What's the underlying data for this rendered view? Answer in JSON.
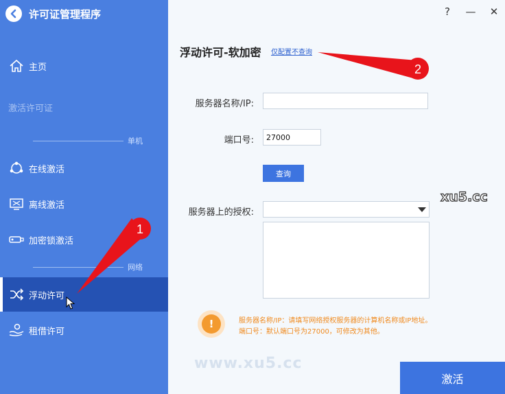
{
  "app": {
    "title": "许可证管理程序"
  },
  "sidebar": {
    "items": [
      {
        "label": "主页",
        "icon": "home-icon"
      },
      {
        "label": "激活许可证",
        "icon": ""
      },
      {
        "label": "在线激活",
        "icon": "network-icon"
      },
      {
        "label": "离线激活",
        "icon": "monitor-icon"
      },
      {
        "label": "加密锁激活",
        "icon": "usb-key-icon"
      },
      {
        "label": "浮动许可",
        "icon": "shuffle-icon"
      },
      {
        "label": "租借许可",
        "icon": "hand-icon"
      }
    ],
    "sections": {
      "single": "单机",
      "network": "网络"
    }
  },
  "window": {
    "help": "?",
    "minimize": "—",
    "close": "✕"
  },
  "main": {
    "title": "浮动许可-软加密",
    "config_link": "仅配置不查询",
    "server_label": "服务器名称/IP:",
    "server_value": "",
    "port_label": "端口号:",
    "port_value": "27000",
    "query_button": "查询",
    "license_label": "服务器上的授权:",
    "license_value": "",
    "hint_line1": "服务器名称/IP：请填写网络授权服务器的计算机名称或IP地址。",
    "hint_line2": "端口号：默认端口号为27000，可修改为其他。",
    "activate_button": "激活"
  },
  "annotations": {
    "marker1": "1",
    "marker2": "2"
  },
  "watermark": {
    "small": "xu5.cc",
    "large": "www.xu5.cc"
  },
  "colors": {
    "sidebar": "#4a7fe0",
    "sidebar_active": "#2552b3",
    "button": "#3d74e0",
    "hint": "#f08a1e",
    "annotation": "#e8141b"
  }
}
